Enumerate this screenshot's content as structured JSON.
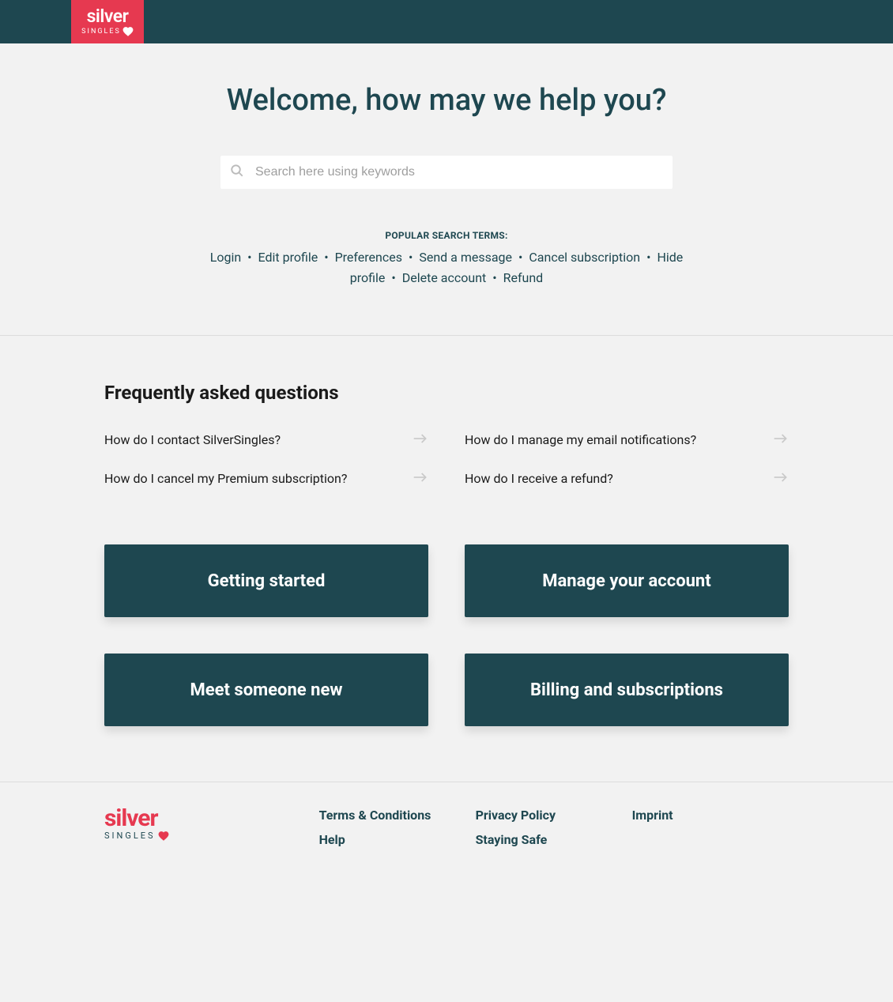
{
  "brand": {
    "name_top": "silver",
    "name_bottom": "SINGLES"
  },
  "hero": {
    "title": "Welcome, how may we help you?"
  },
  "search": {
    "placeholder": "Search here using keywords",
    "value": ""
  },
  "popular": {
    "label": "POPULAR SEARCH TERMS:",
    "terms": [
      "Login",
      "Edit profile",
      "Preferences",
      "Send a message",
      "Cancel subscription",
      "Hide profile",
      "Delete account",
      "Refund"
    ]
  },
  "faq": {
    "title": "Frequently asked questions",
    "items": [
      "How do I contact SilverSingles?",
      "How do I manage my email notifications?",
      "How do I cancel my Premium subscription?",
      "How do I receive a refund?"
    ]
  },
  "topics": [
    "Getting started",
    "Manage your account",
    "Meet someone new",
    "Billing and subscriptions"
  ],
  "footer": {
    "links": [
      "Terms & Conditions",
      "Privacy Policy",
      "Imprint",
      "Help",
      "Staying Safe"
    ]
  }
}
